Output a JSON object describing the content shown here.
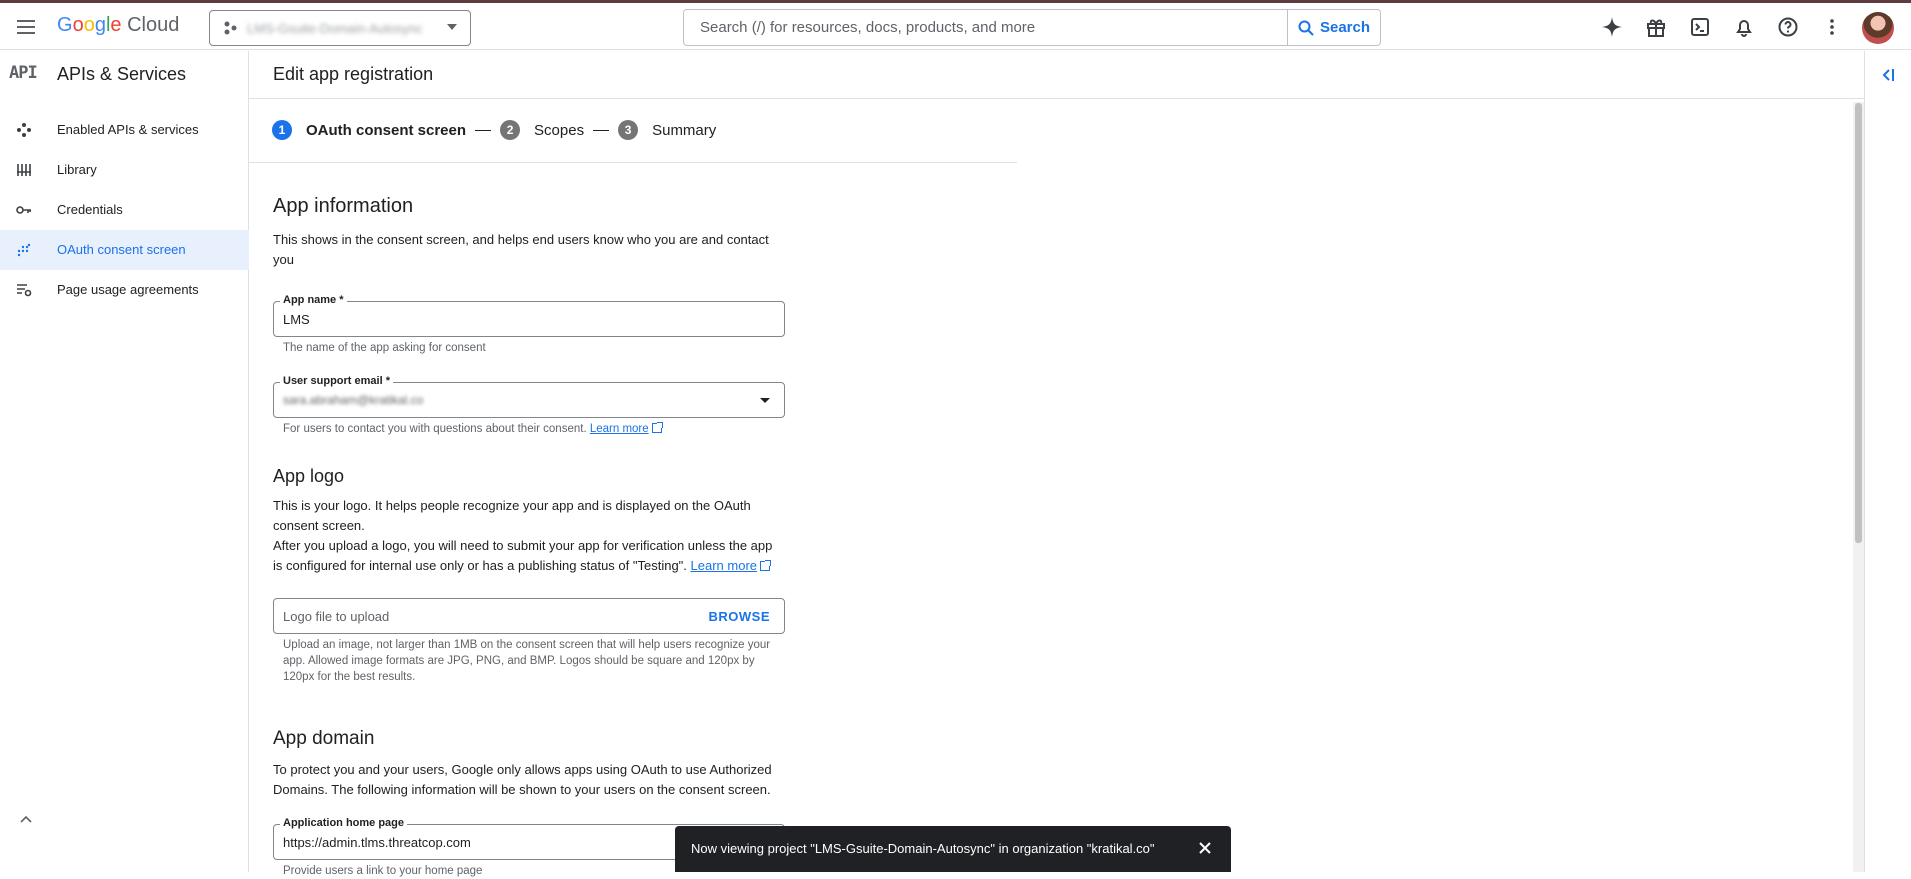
{
  "header": {
    "logo": {
      "g1": "G",
      "g2": "o",
      "g3": "o",
      "g4": "g",
      "g5": "l",
      "g6": "e",
      "cloud": "Cloud"
    },
    "project_name": "LMS-Gsuite-Domain-Autosync",
    "search_placeholder": "Search (/) for resources, docs, products, and more",
    "search_button": "Search",
    "icons": [
      "gemini-icon",
      "gift-icon",
      "terminal-icon",
      "bell-icon",
      "help-icon",
      "more-vert-icon"
    ]
  },
  "sidebar": {
    "logo_text": "API",
    "title": "APIs & Services",
    "items": [
      {
        "label": "Enabled APIs & services",
        "icon": "diamond-icon"
      },
      {
        "label": "Library",
        "icon": "library-icon"
      },
      {
        "label": "Credentials",
        "icon": "key-icon"
      },
      {
        "label": "OAuth consent screen",
        "icon": "dots-icon",
        "active": true
      },
      {
        "label": "Page usage agreements",
        "icon": "settings-list-icon"
      }
    ]
  },
  "page": {
    "title": "Edit app registration",
    "steps": [
      {
        "num": "1",
        "label": "OAuth consent screen",
        "active": true
      },
      {
        "num": "2",
        "label": "Scopes"
      },
      {
        "num": "3",
        "label": "Summary"
      }
    ]
  },
  "app_info": {
    "heading": "App information",
    "desc": "This shows in the consent screen, and helps end users know who you are and contact you",
    "app_name_label": "App name *",
    "app_name_value": "LMS",
    "app_name_hint": "The name of the app asking for consent",
    "email_label": "User support email *",
    "email_value": "sara.abraham@kratikal.co",
    "email_hint": "For users to contact you with questions about their consent.",
    "learn_more": "Learn more"
  },
  "app_logo": {
    "heading": "App logo",
    "desc1": "This is your logo. It helps people recognize your app and is displayed on the OAuth consent screen.",
    "desc2": "After you upload a logo, you will need to submit your app for verification unless the app is configured for internal use only or has a publishing status of \"Testing\".",
    "learn_more": "Learn more",
    "upload_placeholder": "Logo file to upload",
    "browse": "BROWSE",
    "hint": "Upload an image, not larger than 1MB on the consent screen that will help users recognize your app. Allowed image formats are JPG, PNG, and BMP. Logos should be square and 120px by 120px for the best results."
  },
  "app_domain": {
    "heading": "App domain",
    "desc": "To protect you and your users, Google only allows apps using OAuth to use Authorized Domains. The following information will be shown to your users on the consent screen.",
    "home_label": "Application home page",
    "home_value": "https://admin.tlms.threatcop.com",
    "home_hint": "Provide users a link to your home page"
  },
  "toast": {
    "message": "Now viewing project \"LMS-Gsuite-Domain-Autosync\" in organization \"kratikal.co\""
  },
  "colors": {
    "accent": "#1a73e8",
    "toast_bg": "#202124",
    "active_bg": "#e8f0fe"
  }
}
